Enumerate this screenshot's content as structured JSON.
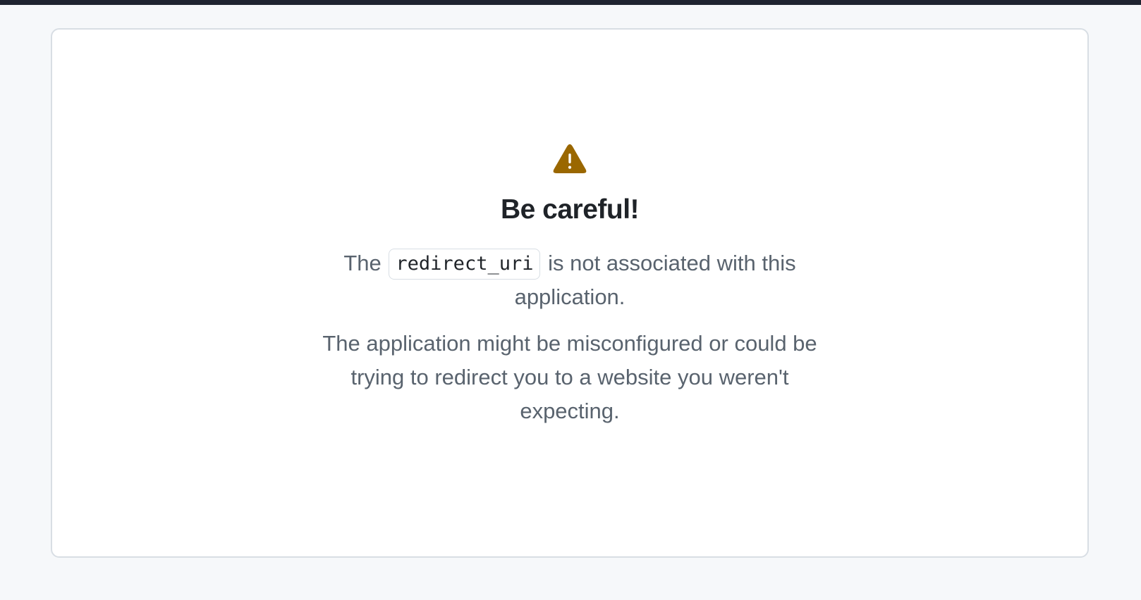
{
  "page": {
    "background": "#f6f8fa",
    "topbar_color": "#1f2430"
  },
  "alert": {
    "icon": "alert-triangle-icon",
    "icon_color": "#9a6700",
    "heading": "Be careful!",
    "message_prefix": "The",
    "code": "redirect_uri",
    "message_suffix": "is not associated with this application.",
    "detail": "The application might be misconfigured or could be trying to redirect you to a website you weren't expecting."
  }
}
